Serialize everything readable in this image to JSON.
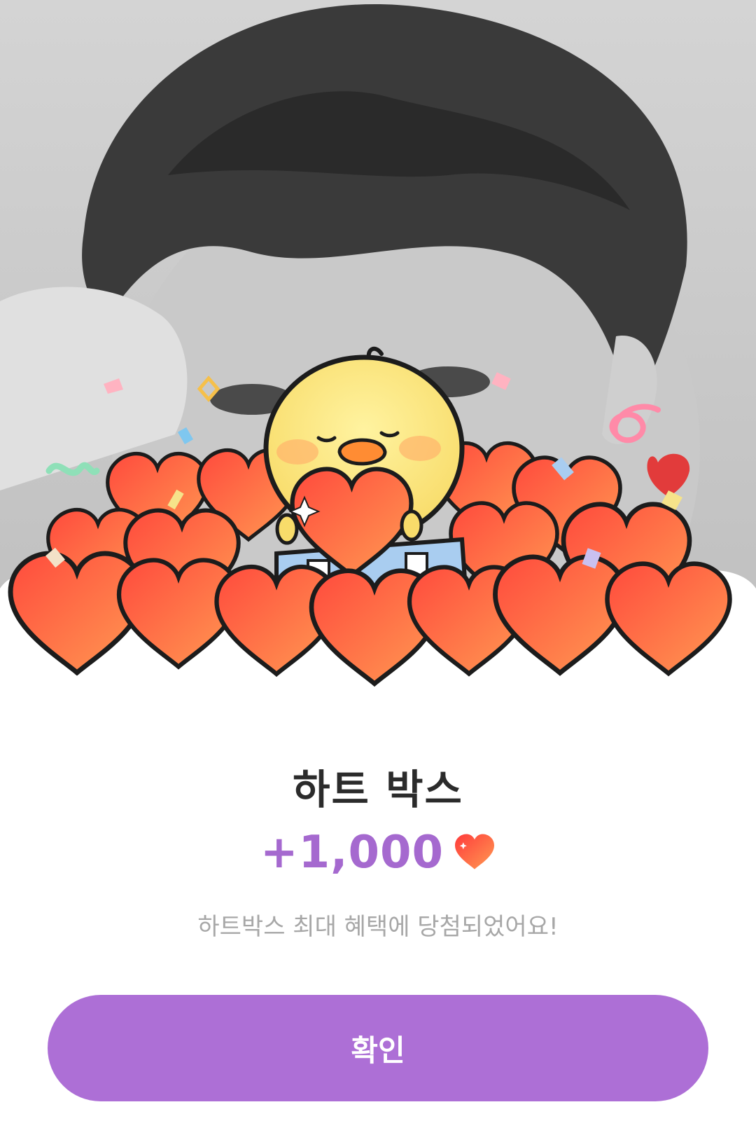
{
  "reward": {
    "title": "하트 박스",
    "amount": "+1,000",
    "amount_icon": "heart-icon",
    "message": "하트박스 최대 혜택에 당첨되었어요!",
    "confirm_label": "확인"
  },
  "colors": {
    "accent": "#ad6fd6",
    "amount_text": "#a569cf",
    "heart": "#ff5a3c",
    "title_text": "#2b2b2b",
    "message_text": "#a7a7a7"
  }
}
